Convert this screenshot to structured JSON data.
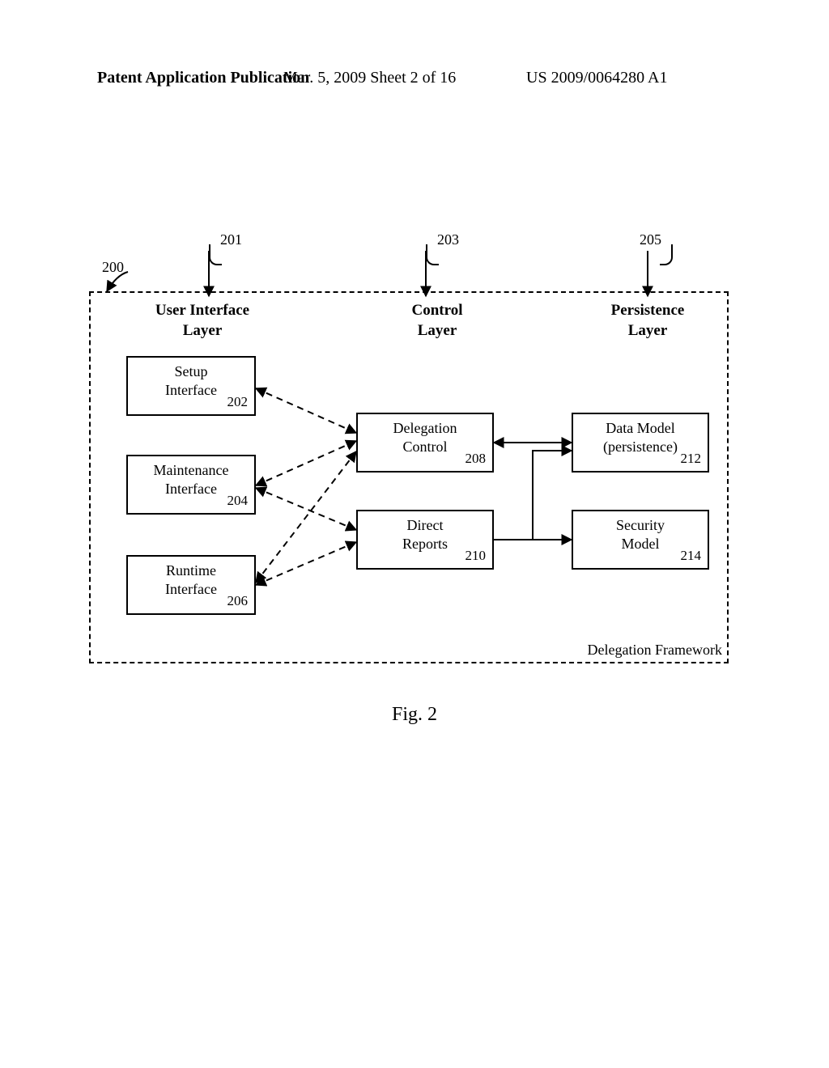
{
  "header": {
    "left": "Patent Application Publication",
    "center": "Mar. 5, 2009  Sheet 2 of 16",
    "right": "US 2009/0064280 A1"
  },
  "figure_caption": "Fig. 2",
  "framework_label": "Delegation Framework",
  "layers": {
    "ui": "User Interface\nLayer",
    "control": "Control\nLayer",
    "persistence": "Persistence\nLayer"
  },
  "refs": {
    "r200": "200",
    "r201": "201",
    "r203": "203",
    "r205": "205"
  },
  "boxes": {
    "setup": {
      "label": "Setup\nInterface",
      "num": "202"
    },
    "maint": {
      "label": "Maintenance\nInterface",
      "num": "204"
    },
    "runtime": {
      "label": "Runtime\nInterface",
      "num": "206"
    },
    "deleg": {
      "label": "Delegation\nControl",
      "num": "208"
    },
    "direct": {
      "label": "Direct\nReports",
      "num": "210"
    },
    "data": {
      "label": "Data Model\n(persistence)",
      "num": "212"
    },
    "sec": {
      "label": "Security\nModel",
      "num": "214"
    }
  }
}
